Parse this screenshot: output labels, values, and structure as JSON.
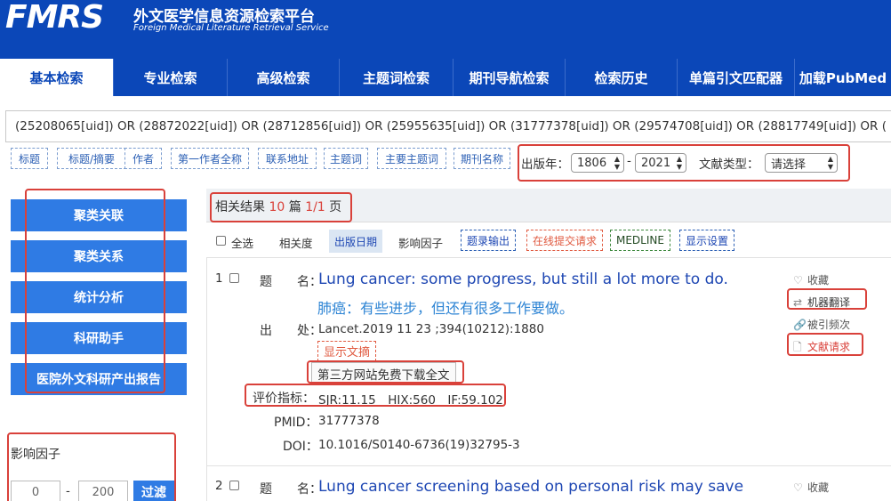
{
  "brand": {
    "mark": "FMRS",
    "name_cn": "外文医学信息资源检索平台",
    "name_en": "Foreign Medical Literature Retrieval Service"
  },
  "nav": {
    "tabs": [
      "基本检索",
      "专业检索",
      "高级检索",
      "主题词检索",
      "期刊导航检索",
      "检索历史",
      "单篇引文匹配器",
      "加载PubMed"
    ],
    "active_index": 0
  },
  "search": {
    "query": "(25208065[uid]) OR (28872022[uid]) OR (28712856[uid]) OR (25955635[uid]) OR (31777378[uid]) OR (29574708[uid]) OR (28817749[uid]) OR (",
    "fields": [
      "标题",
      "标题/摘要",
      "作者",
      "第一作者全称",
      "联系地址",
      "主题词",
      "主要主题词",
      "期刊名称"
    ],
    "year_label": "出版年：",
    "year_from": "1806",
    "year_sep": "-",
    "year_to": "2021",
    "doctype_label": "文献类型：",
    "doctype_value": "请选择"
  },
  "sidebar": {
    "buttons": [
      "聚类关联",
      "聚类关系",
      "统计分析",
      "科研助手",
      "医院外文科研产出报告"
    ],
    "impact_title": "影响因子",
    "impact_min": "0",
    "impact_sep": "-",
    "impact_max": "200",
    "filter_label": "过滤"
  },
  "results": {
    "prefix": "相关结果",
    "count": "10",
    "unit": "篇",
    "pages": "1/1",
    "page_unit": "页"
  },
  "toolbar": {
    "select_all": "全选",
    "sort_relevance": "相关度",
    "sort_date": "出版日期",
    "sort_if": "影响因子",
    "export": "题录输出",
    "online_request": "在线提交请求",
    "medline": "MEDLINE",
    "display_settings": "显示设置"
  },
  "record_labels": {
    "title": "题　　名：",
    "source": "出　　处：",
    "metrics": "评价指标：",
    "pmid": "PMID：",
    "doi": "DOI：",
    "show_abstract": "显示文摘",
    "free_download": "第三方网站免费下载全文"
  },
  "actions": {
    "favorite": "收藏",
    "translate": "机器翻译",
    "cited": "被引频次",
    "request": "文献请求"
  },
  "records": [
    {
      "num": "1",
      "title_en": "Lung cancer: some progress, but still a lot more to do.",
      "title_cn": "肺癌：有些进步，但还有很多工作要做。",
      "source": "Lancet.2019 11 23 ;394(10212):1880",
      "metrics": "SJR:11.15　HIX:560　IF:59.102",
      "pmid": "31777378",
      "doi": "10.1016/S0140-6736(19)32795-3"
    },
    {
      "num": "2",
      "title_en": "Lung cancer screening based on personal risk may save"
    }
  ],
  "colors": {
    "brand_blue": "#0b47b8",
    "button_blue": "#2f7be4",
    "highlight_red": "#d9413a",
    "link_blue": "#1e47b3"
  }
}
